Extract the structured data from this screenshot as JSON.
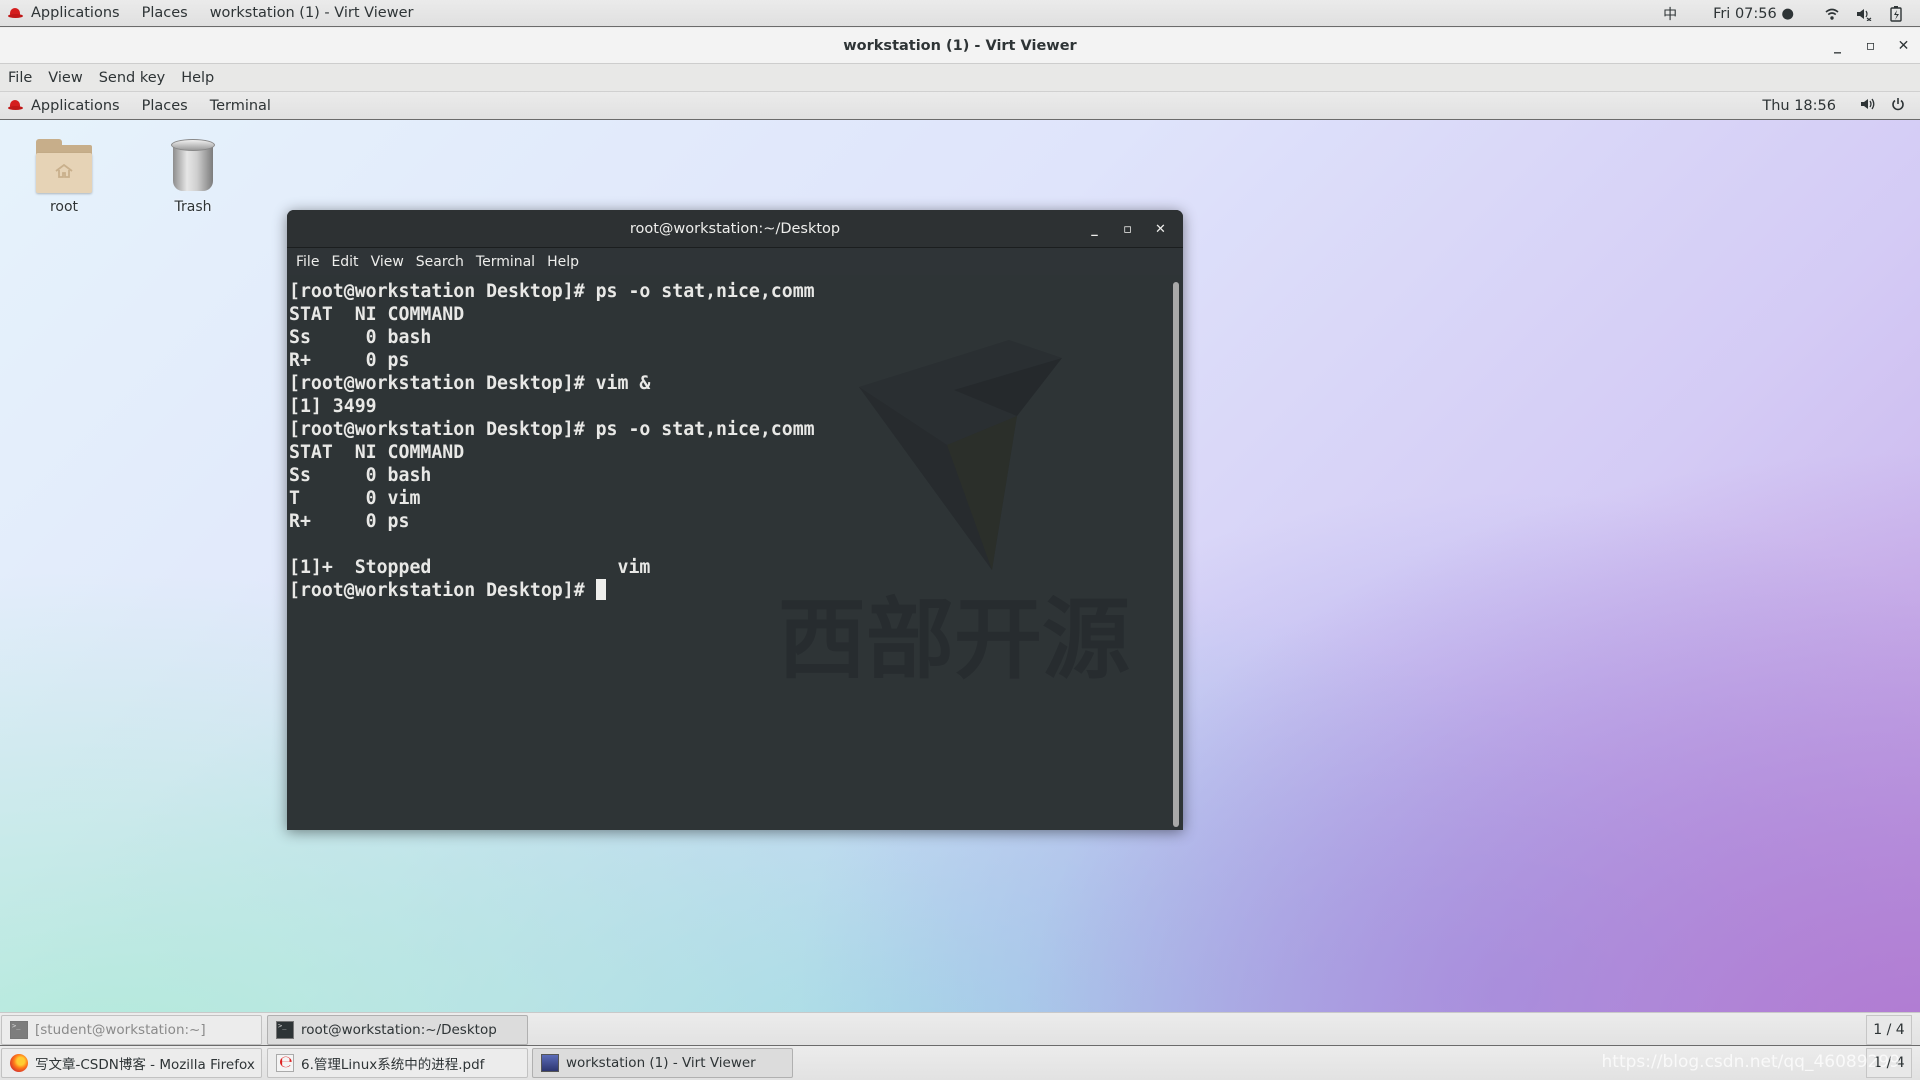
{
  "host_topbar": {
    "applications": "Applications",
    "places": "Places",
    "active_window": "workstation (1) - Virt Viewer",
    "ime": "中",
    "clock": "Fri 07:56 ●",
    "icons": [
      "wifi-icon",
      "volume-muted-icon",
      "battery-charging-icon"
    ]
  },
  "virt_viewer": {
    "title": "workstation (1) - Virt Viewer",
    "menu": [
      "File",
      "View",
      "Send key",
      "Help"
    ],
    "controls": {
      "minimize": "_",
      "maximize": "▫",
      "close": "✕"
    }
  },
  "guest_panel": {
    "applications": "Applications",
    "places": "Places",
    "active_app": "Terminal",
    "clock": "Thu 18:56",
    "icons": [
      "volume-icon",
      "power-icon"
    ]
  },
  "desktop_icons": [
    {
      "label": "root",
      "icon": "home-folder-icon"
    },
    {
      "label": "Trash",
      "icon": "trash-icon"
    }
  ],
  "terminal": {
    "title": "root@workstation:~/Desktop",
    "controls": {
      "minimize": "_",
      "maximize": "▫",
      "close": "✕"
    },
    "menu": [
      "File",
      "Edit",
      "View",
      "Search",
      "Terminal",
      "Help"
    ],
    "lines": [
      "[root@workstation Desktop]# ps -o stat,nice,comm",
      "STAT  NI COMMAND",
      "Ss     0 bash",
      "R+     0 ps",
      "[root@workstation Desktop]# vim &",
      "[1] 3499",
      "[root@workstation Desktop]# ps -o stat,nice,comm",
      "STAT  NI COMMAND",
      "Ss     0 bash",
      "T      0 vim",
      "R+     0 ps",
      "",
      "[1]+  Stopped                 vim",
      "[root@workstation Desktop]# "
    ],
    "watermark_text": "西部开源"
  },
  "guest_taskbar": {
    "items": [
      {
        "label": "[student@workstation:~]",
        "icon": "terminal-icon",
        "state": "minimized"
      },
      {
        "label": "root@workstation:~/Desktop",
        "icon": "terminal-icon",
        "state": "active"
      }
    ],
    "workspace": "1 / 4"
  },
  "host_taskbar": {
    "items": [
      {
        "label": "写文章-CSDN博客 - Mozilla Firefox",
        "icon": "firefox-icon"
      },
      {
        "label": "6.管理Linux系统中的进程.pdf",
        "icon": "pdf-viewer-icon"
      },
      {
        "label": "workstation (1) - Virt Viewer",
        "icon": "virt-viewer-icon",
        "state": "active"
      }
    ],
    "workspace": "1 / 4",
    "overlay_watermark": "https://blog.csdn.net/qq_46089299"
  }
}
